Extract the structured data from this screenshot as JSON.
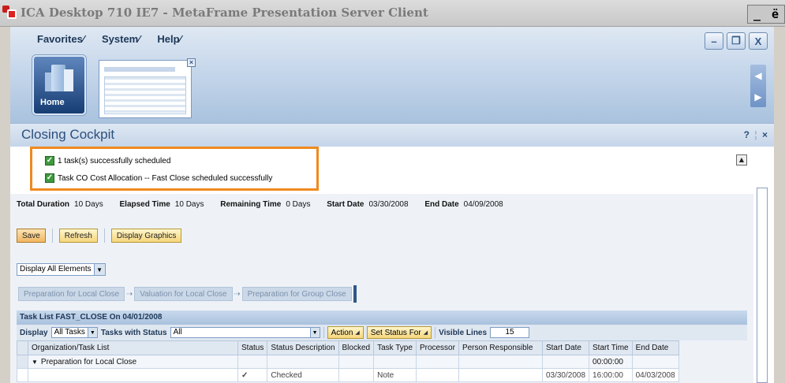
{
  "window": {
    "title": "ICA Desktop 710 IE7 - MetaFrame Presentation Server Client",
    "controls": [
      "_",
      "ё"
    ]
  },
  "menu": {
    "items": [
      "Favorites⁄",
      "System⁄",
      "Help⁄"
    ]
  },
  "header_buttons": [
    "–",
    "❐",
    "X"
  ],
  "home": {
    "label": "Home"
  },
  "page": {
    "title": "Closing Cockpit",
    "help": "?",
    "close": "×"
  },
  "messages": [
    {
      "text": "1 task(s) successfully scheduled",
      "status": "success"
    },
    {
      "text": "Task CO Cost Allocation -- Fast Close scheduled successfully",
      "status": "success"
    }
  ],
  "summary": {
    "total_duration": {
      "label": "Total Duration",
      "value": "10 Days"
    },
    "elapsed_time": {
      "label": "Elapsed Time",
      "value": "10 Days"
    },
    "remaining_time": {
      "label": "Remaining Time",
      "value": "0 Days"
    },
    "start_date": {
      "label": "Start Date",
      "value": "03/30/2008"
    },
    "end_date": {
      "label": "End Date",
      "value": "04/09/2008"
    }
  },
  "toolbar": {
    "save": "Save",
    "refresh": "Refresh",
    "display_graphics": "Display Graphics"
  },
  "display_elements": {
    "value": "Display All Elements"
  },
  "phases": [
    "Preparation for Local Close",
    "Valuation for Local Close",
    "Preparation for Group Close"
  ],
  "task_list": {
    "title": "Task List FAST_CLOSE On 04/01/2008",
    "display_label": "Display",
    "display_value": "All Tasks",
    "tasks_with_status_label": "Tasks with Status",
    "tasks_with_status_value": "All",
    "action_label": "Action",
    "set_status_label": "Set Status For",
    "visible_lines_label": "Visible Lines",
    "visible_lines_value": "15",
    "columns": [
      "Organization/Task List",
      "Status",
      "Status Description",
      "Blocked",
      "Task Type",
      "Processor",
      "Person Responsible",
      "Start Date",
      "Start Time",
      "End Date"
    ],
    "rows": [
      [
        "Preparation for Local Close",
        "",
        "",
        "",
        "",
        "",
        "",
        "",
        "00:00:00",
        ""
      ],
      [
        "",
        "✓",
        "Checked",
        "",
        "Note",
        "",
        "",
        "03/30/2008",
        "16:00:00",
        "04/03/2008"
      ]
    ]
  },
  "colors": {
    "highlight_box": "#f08a1f",
    "brand_blue": "#2e5787"
  }
}
